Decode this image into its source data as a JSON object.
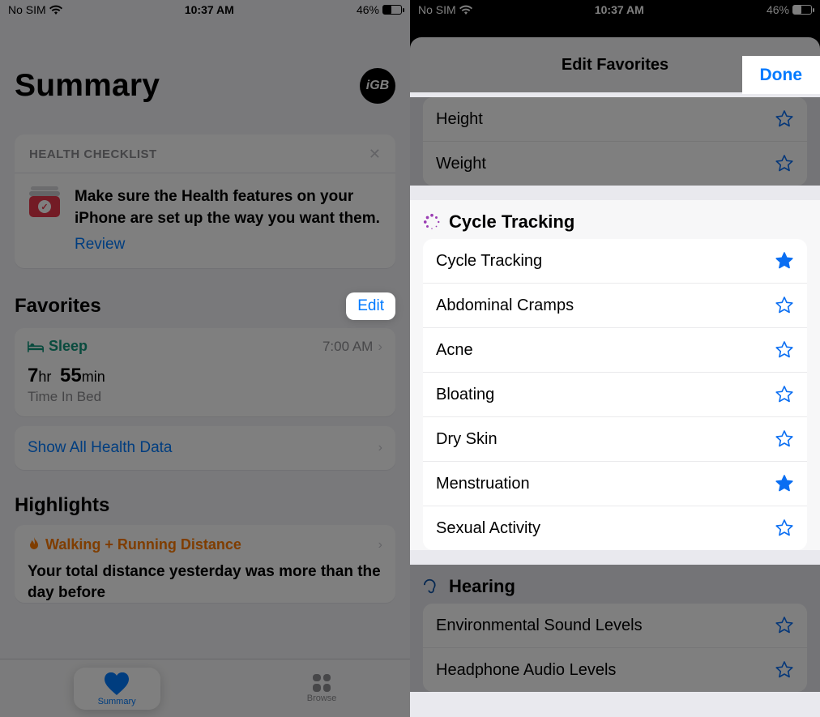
{
  "status": {
    "carrier": "No SIM",
    "time": "10:37 AM",
    "battery_pct": "46%"
  },
  "left": {
    "title": "Summary",
    "avatar": "iGB",
    "checklist": {
      "heading": "HEALTH CHECKLIST",
      "text": "Make sure the Health features on your iPhone are set up the way you want them.",
      "review": "Review"
    },
    "favorites": {
      "title": "Favorites",
      "edit": "Edit",
      "sleep_label": "Sleep",
      "sleep_time": "7:00 AM",
      "duration_h": "7",
      "duration_h_unit": "hr",
      "duration_m": "55",
      "duration_m_unit": "min",
      "tib": "Time In Bed",
      "show_all": "Show All Health Data"
    },
    "highlights": {
      "title": "Highlights",
      "metric": "Walking + Running Distance",
      "body": "Your total distance yesterday was more than the day before"
    },
    "tabs": {
      "summary": "Summary",
      "browse": "Browse"
    }
  },
  "right": {
    "header_title": "Edit Favorites",
    "done": "Done",
    "top_items": [
      {
        "label": "Height",
        "filled": false
      },
      {
        "label": "Weight",
        "filled": false
      }
    ],
    "cycle": {
      "title": "Cycle Tracking",
      "items": [
        {
          "label": "Cycle Tracking",
          "filled": true
        },
        {
          "label": "Abdominal Cramps",
          "filled": false
        },
        {
          "label": "Acne",
          "filled": false
        },
        {
          "label": "Bloating",
          "filled": false
        },
        {
          "label": "Dry Skin",
          "filled": false
        },
        {
          "label": "Menstruation",
          "filled": true
        },
        {
          "label": "Sexual Activity",
          "filled": false
        }
      ]
    },
    "hearing": {
      "title": "Hearing",
      "items": [
        {
          "label": "Environmental Sound Levels",
          "filled": false
        },
        {
          "label": "Headphone Audio Levels",
          "filled": false
        }
      ]
    }
  }
}
